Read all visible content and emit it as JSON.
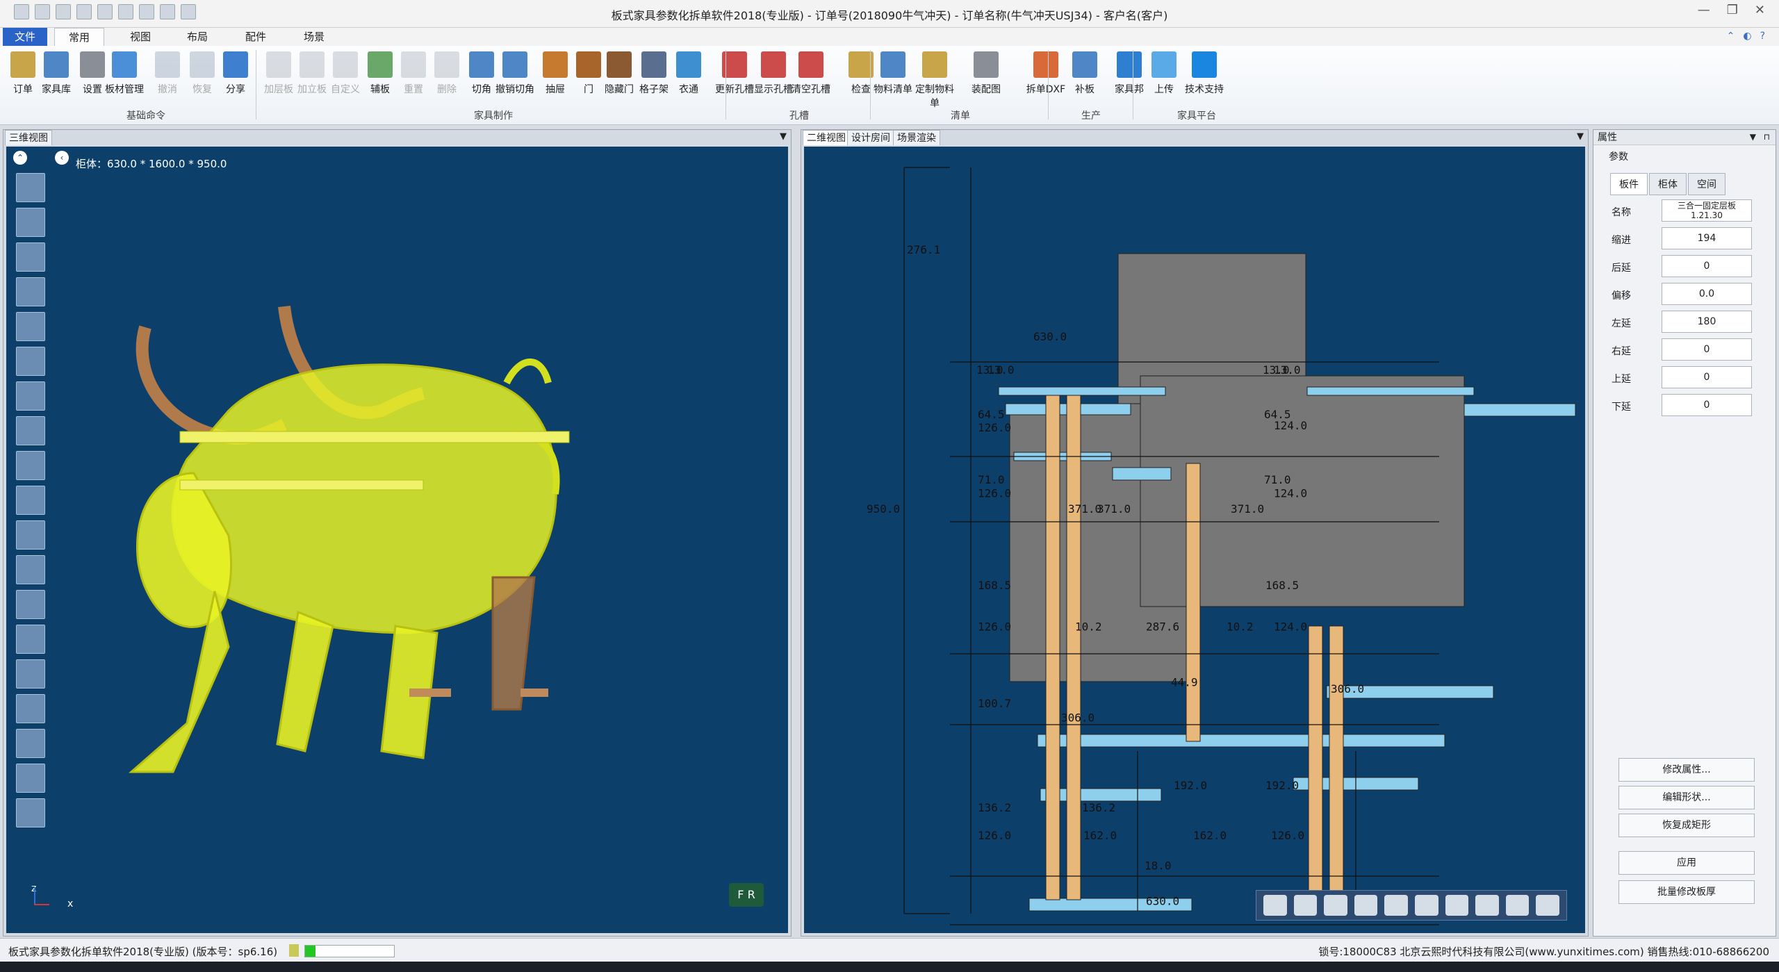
{
  "window": {
    "title": "板式家具参数化拆单软件2018(专业版) - 订单号(2018090牛气冲天) - 订单名称(牛气冲天USJ34) - 客户名(客户)"
  },
  "menu": {
    "file": "文件",
    "tabs": [
      "常用",
      "视图",
      "布局",
      "配件",
      "场景"
    ]
  },
  "ribbon": {
    "buttons": [
      {
        "label": "订单",
        "enabled": true,
        "color": "#c9a54a"
      },
      {
        "label": "家具库",
        "enabled": true,
        "color": "#4f86c6"
      },
      {
        "label": "设置",
        "enabled": true,
        "color": "#8a8f97"
      },
      {
        "label": "板材管理",
        "enabled": true,
        "color": "#4a8fd8"
      },
      {
        "label": "撤消",
        "enabled": false,
        "color": "#7a8fa8"
      },
      {
        "label": "恢复",
        "enabled": false,
        "color": "#7a8fa8"
      },
      {
        "label": "分享",
        "enabled": true,
        "color": "#3e7fcf"
      },
      {
        "label": "加层板",
        "enabled": false,
        "color": "#9aa4b0"
      },
      {
        "label": "加立板",
        "enabled": false,
        "color": "#9aa4b0"
      },
      {
        "label": "自定义",
        "enabled": false,
        "color": "#9aa4b0"
      },
      {
        "label": "辅板",
        "enabled": true,
        "color": "#6aa86a"
      },
      {
        "label": "重置",
        "enabled": false,
        "color": "#9aa4b0"
      },
      {
        "label": "删除",
        "enabled": false,
        "color": "#9aa4b0"
      },
      {
        "label": "切角",
        "enabled": true,
        "color": "#4f86c6"
      },
      {
        "label": "撤销切角",
        "enabled": true,
        "color": "#4f86c6"
      },
      {
        "label": "抽屉",
        "enabled": true,
        "color": "#c57a2f"
      },
      {
        "label": "门",
        "enabled": true,
        "color": "#a8652b"
      },
      {
        "label": "隐藏门",
        "enabled": true,
        "color": "#8b5a32"
      },
      {
        "label": "格子架",
        "enabled": true,
        "color": "#5a6f8f"
      },
      {
        "label": "衣通",
        "enabled": true,
        "color": "#3e8fcf"
      },
      {
        "label": "更新孔槽",
        "enabled": true,
        "color": "#cc4b4b"
      },
      {
        "label": "显示孔槽",
        "enabled": true,
        "color": "#cc4b4b"
      },
      {
        "label": "清空孔槽",
        "enabled": true,
        "color": "#cc4b4b"
      },
      {
        "label": "检查",
        "enabled": true,
        "color": "#c9a54a"
      },
      {
        "label": "物料清单",
        "enabled": true,
        "color": "#4f86c6"
      },
      {
        "label": "定制物料单",
        "enabled": true,
        "color": "#c9a54a"
      },
      {
        "label": "装配图",
        "enabled": true,
        "color": "#8a8f97"
      },
      {
        "label": "拆单DXF",
        "enabled": true,
        "color": "#d86a3a"
      },
      {
        "label": "补板",
        "enabled": true,
        "color": "#4f86c6"
      },
      {
        "label": "家具邦",
        "enabled": true,
        "color": "#2f7fd0"
      },
      {
        "label": "上传",
        "enabled": true,
        "color": "#5aaae8"
      },
      {
        "label": "技术支持",
        "enabled": true,
        "color": "#1a86e0"
      }
    ],
    "groups": [
      "基础命令",
      "家具制作",
      "孔槽",
      "清单",
      "生产",
      "家具平台"
    ]
  },
  "panel3d": {
    "tab": "三维视图",
    "dims_text": "柜体：630.0 * 1600.0 * 950.0",
    "icon_names": [
      "add-panel-icon",
      "remove-panel-icon",
      "rotate-icon",
      "zoom-icon",
      "fit-icon",
      "binoculars-icon",
      "doc-icon",
      "box-icon",
      "pie-icon",
      "chart-icon",
      "contrast-icon",
      "camera-icon",
      "wireframe-icon",
      "export-icon",
      "layout-icon",
      "refresh-icon",
      "search-icon",
      "list-icon",
      "dxf-icon"
    ],
    "axis_x": "x",
    "axis_z": "z",
    "badge": "F R"
  },
  "panel2d": {
    "tabs": [
      "二维视图",
      "设计房间",
      "场景渲染"
    ],
    "dims": [
      "276.1",
      "630.0",
      "13.0",
      "13.0",
      "13.0",
      "13.0",
      "64.5",
      "64.5",
      "126.0",
      "124.0",
      "71.0",
      "71.0",
      "126.0",
      "124.0",
      "950.0",
      "371.0",
      "371.0",
      "371.0",
      "168.5",
      "168.5",
      "126.0",
      "10.2",
      "287.6",
      "10.2",
      "124.0",
      "44.9",
      "306.0",
      "100.7",
      "306.0",
      "192.0",
      "192.0",
      "136.2",
      "136.2",
      "126.0",
      "162.0",
      "162.0",
      "126.0",
      "18.0",
      "630.0"
    ]
  },
  "props": {
    "title": "属性",
    "section": "参数",
    "tabs": [
      "板件",
      "柜体",
      "空间"
    ],
    "fields": [
      {
        "label": "名称",
        "value": "三合一固定层板1.21.30"
      },
      {
        "label": "缩进",
        "value": "194"
      },
      {
        "label": "后延",
        "value": "0"
      },
      {
        "label": "偏移",
        "value": "0.0"
      },
      {
        "label": "左延",
        "value": "180"
      },
      {
        "label": "右延",
        "value": "0"
      },
      {
        "label": "上延",
        "value": "0"
      },
      {
        "label": "下延",
        "value": "0"
      }
    ],
    "buttons": [
      "修改属性...",
      "编辑形状...",
      "恢复成矩形",
      "应用",
      "批量修改板厚"
    ]
  },
  "status": {
    "left": "板式家具参数化拆单软件2018(专业版) (版本号：sp6.16)",
    "progress": 0.12,
    "right": "锁号:18000C83 北京云熙时代科技有限公司(www.yunxitimes.com) 销售热线:010-68866200"
  }
}
